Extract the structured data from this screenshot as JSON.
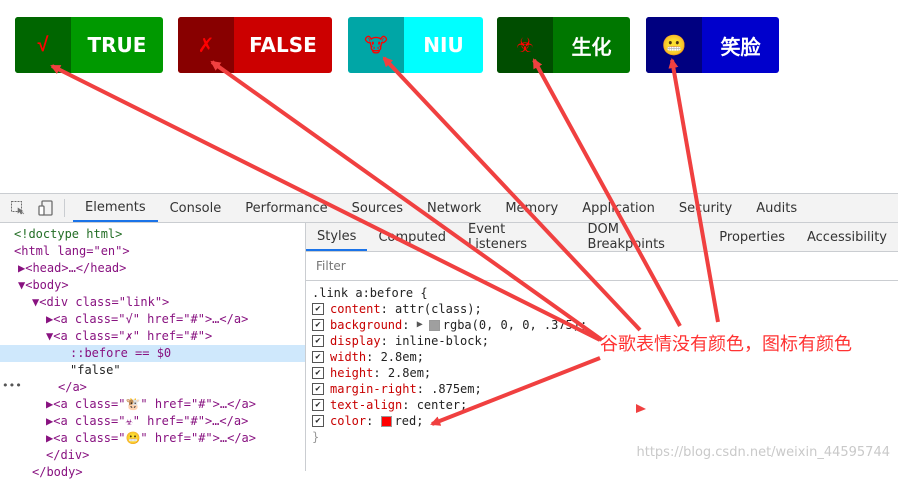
{
  "buttons": [
    {
      "icon": "√",
      "label": "TRUE",
      "color": "#009900",
      "iconbg": "#006600"
    },
    {
      "icon": "✗",
      "label": "FALSE",
      "color": "#cc0000",
      "iconbg": "#880000"
    },
    {
      "icon": "🐮",
      "label": "NIU",
      "color": "#00ffff",
      "iconbg": "#00a6a6"
    },
    {
      "icon": "☣",
      "label": "生化",
      "color": "#007700",
      "iconbg": "#004d00"
    },
    {
      "icon": "😬",
      "label": "笑脸",
      "color": "#0000cc",
      "iconbg": "#000080"
    }
  ],
  "devtools": {
    "tabs": [
      "Elements",
      "Console",
      "Performance",
      "Sources",
      "Network",
      "Memory",
      "Application",
      "Security",
      "Audits"
    ],
    "active_tab": "Elements",
    "dom": [
      "<!doctype html>",
      "<html lang=\"en\">",
      "▶<head>…</head>",
      "▼<body>",
      "▼<div class=\"link\">",
      "▶<a class=\"√\" href=\"#\">…</a>",
      "▼<a class=\"✗\" href=\"#\">",
      "::before == $0",
      "\"false\"",
      "</a>",
      "▶<a class=\"🐮\" href=\"#\">…</a>",
      "▶<a class=\"☣\" href=\"#\">…</a>",
      "▶<a class=\"😬\" href=\"#\">…</a>",
      "</div>",
      "</body>"
    ],
    "styles_tabs": [
      "Styles",
      "Computed",
      "Event Listeners",
      "DOM Breakpoints",
      "Properties",
      "Accessibility"
    ],
    "filter_placeholder": "Filter",
    "selector": ".link a:before {",
    "declarations": [
      {
        "prop": "content",
        "value": "attr(class);"
      },
      {
        "prop": "background",
        "value": "rgba(0, 0, 0, .375);"
      },
      {
        "prop": "display",
        "value": "inline-block;"
      },
      {
        "prop": "width",
        "value": "2.8em;"
      },
      {
        "prop": "height",
        "value": "2.8em;"
      },
      {
        "prop": "margin-right",
        "value": ".875em;"
      },
      {
        "prop": "text-align",
        "value": "center;"
      },
      {
        "prop": "color",
        "value": "red;"
      }
    ],
    "close_brace": "}"
  },
  "annotation": "谷歌表情没有颜色，图标有颜色",
  "watermark": "https://blog.csdn.net/weixin_44595744",
  "colors": {
    "arrow": "#f04040",
    "annotation": "#ff3333"
  }
}
